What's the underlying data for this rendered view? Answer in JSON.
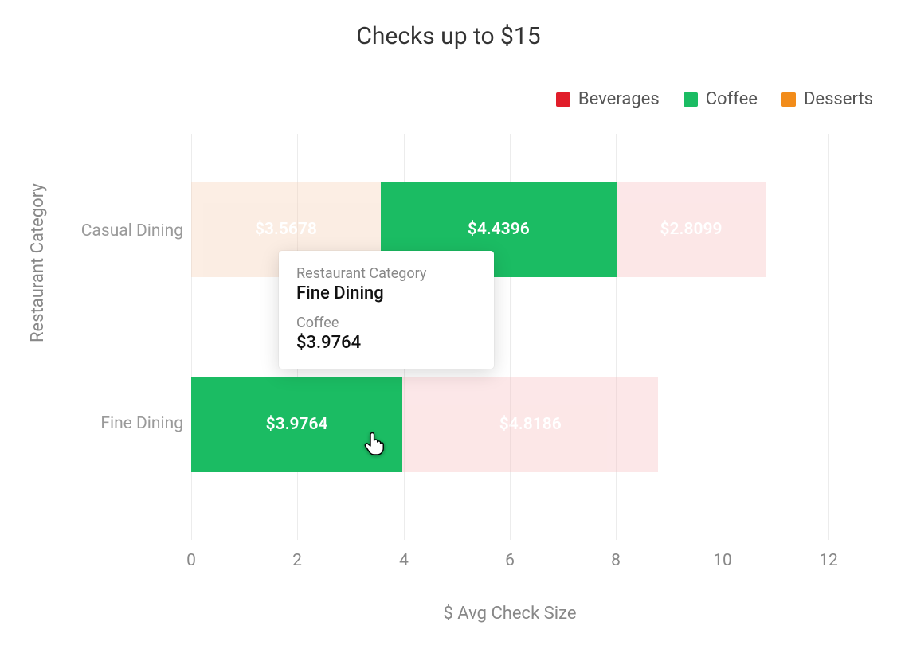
{
  "title": "Checks up to $15",
  "xlabel": "$ Avg Check Size",
  "ylabel": "Restaurant Category",
  "legend": [
    {
      "name": "Beverages",
      "color": "#e11d2a"
    },
    {
      "name": "Coffee",
      "color": "#1bbc63"
    },
    {
      "name": "Desserts",
      "color": "#f28c1a"
    }
  ],
  "xticks": [
    "0",
    "2",
    "4",
    "6",
    "8",
    "10",
    "12"
  ],
  "rows": [
    {
      "category": "Casual Dining",
      "segments": [
        {
          "series": "Beverages",
          "value": 3.5678,
          "label": "$3.5678",
          "highlight": false
        },
        {
          "series": "Coffee",
          "value": 4.4396,
          "label": "$4.4396",
          "highlight": true
        },
        {
          "series": "Desserts",
          "value": 2.8099,
          "label": "$2.8099",
          "highlight": false
        }
      ]
    },
    {
      "category": "Fine Dining",
      "segments": [
        {
          "series": "Coffee",
          "value": 3.9764,
          "label": "$3.9764",
          "highlight": true
        },
        {
          "series": "Desserts",
          "value": 4.8186,
          "label": "$4.8186",
          "highlight": false
        }
      ]
    }
  ],
  "tooltip": {
    "catLabel": "Restaurant Category",
    "catValue": "Fine Dining",
    "seriesLabel": "Coffee",
    "seriesValue": "$3.9764"
  },
  "chart_data": {
    "type": "bar",
    "orientation": "horizontal",
    "stacked": true,
    "title": "Checks up to $15",
    "xlabel": "$ Avg Check Size",
    "ylabel": "Restaurant Category",
    "xlim": [
      0,
      12
    ],
    "categories": [
      "Casual Dining",
      "Fine Dining"
    ],
    "series": [
      {
        "name": "Beverages",
        "color": "#e11d2a",
        "values": [
          3.5678,
          null
        ]
      },
      {
        "name": "Coffee",
        "color": "#1bbc63",
        "values": [
          4.4396,
          3.9764
        ]
      },
      {
        "name": "Desserts",
        "color": "#f28c1a",
        "values": [
          2.8099,
          4.8186
        ]
      }
    ],
    "legend_position": "top-right",
    "hovered": {
      "category": "Fine Dining",
      "series": "Coffee",
      "value": 3.9764
    }
  }
}
